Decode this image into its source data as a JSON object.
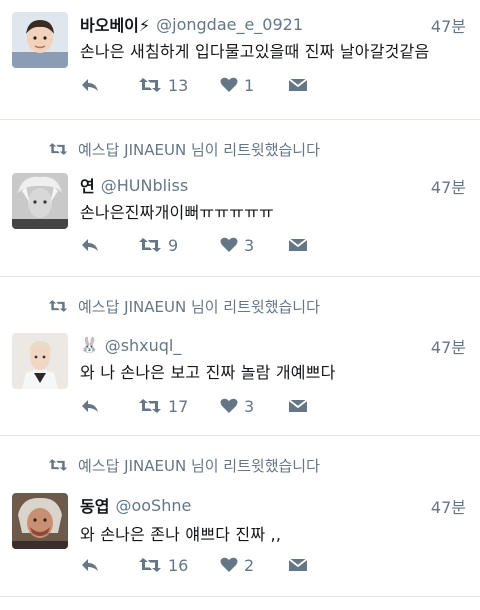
{
  "tweets": [
    {
      "retweeted_by": null,
      "name": "바오베이⚡",
      "handle": "@jongdae_e_0921",
      "time": "47분",
      "text": "손나은 새침하게 입다물고있을때 진짜 날아갈것같음",
      "retweets": "13",
      "likes": "1"
    },
    {
      "retweeted_by": "예스답 JINAEUN 님이 리트윗했습니다",
      "name": "연",
      "handle": "@HUNbliss",
      "time": "47분",
      "text": "손나은진짜개이뻐ㅠㅠㅠㅠㅠ",
      "retweets": "9",
      "likes": "3"
    },
    {
      "retweeted_by": "예스답 JINAEUN 님이 리트윗했습니다",
      "name": "🐰",
      "handle": "@shxuql_",
      "time": "47분",
      "text": "와 나 손나은 보고 진짜 놀람 개예쁘다",
      "retweets": "17",
      "likes": "3"
    },
    {
      "retweeted_by": "예스답 JINAEUN 님이 리트윗했습니다",
      "name": "동엽",
      "handle": "@ooShne",
      "time": "47분",
      "text": "와 손나은 존나 얘쁘다 진짜 ,,",
      "retweets": "16",
      "likes": "2"
    }
  ],
  "icons": {
    "reply": "reply-icon",
    "retweet": "retweet-icon",
    "like": "heart-icon",
    "dm": "envelope-icon"
  },
  "colors": {
    "text": "#14171a",
    "muted": "#657786",
    "divider": "#e1e8ed"
  }
}
